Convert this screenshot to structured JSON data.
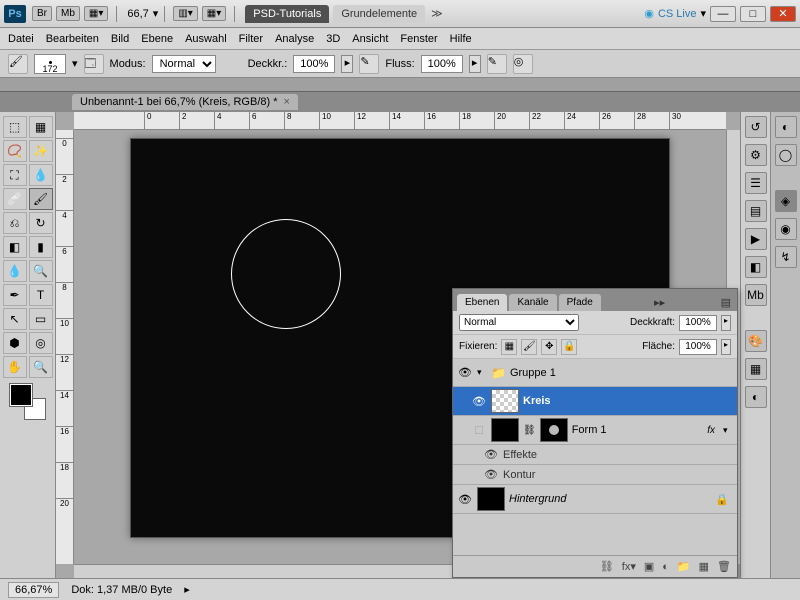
{
  "titlebar": {
    "ps": "Ps",
    "chips": [
      "Br",
      "Mb"
    ],
    "zoom": "66,7",
    "tutorials": "PSD-Tutorials",
    "workspace": "Grundelemente",
    "cslive": "CS Live"
  },
  "menu": [
    "Datei",
    "Bearbeiten",
    "Bild",
    "Ebene",
    "Auswahl",
    "Filter",
    "Analyse",
    "3D",
    "Ansicht",
    "Fenster",
    "Hilfe"
  ],
  "options": {
    "brush_size": "172",
    "mode_label": "Modus:",
    "mode_value": "Normal",
    "opacity_label": "Deckkr.:",
    "opacity_value": "100%",
    "flow_label": "Fluss:",
    "flow_value": "100%"
  },
  "doc_tab": "Unbenannt-1 bei 66,7% (Kreis, RGB/8) *",
  "ruler_h": [
    "0",
    "2",
    "4",
    "6",
    "8",
    "10",
    "12",
    "14",
    "16",
    "18",
    "20",
    "22",
    "24",
    "26",
    "28",
    "30"
  ],
  "ruler_v": [
    "0",
    "2",
    "4",
    "6",
    "8",
    "10",
    "12",
    "14",
    "16",
    "18",
    "20"
  ],
  "status": {
    "zoom": "66,67%",
    "doc": "Dok: 1,37 MB/0 Byte"
  },
  "layers_panel": {
    "tabs": [
      "Ebenen",
      "Kanäle",
      "Pfade"
    ],
    "blend": "Normal",
    "opacity_label": "Deckkraft:",
    "opacity": "100%",
    "lock_label": "Fixieren:",
    "fill_label": "Fläche:",
    "fill": "100%",
    "rows": {
      "group": "Gruppe 1",
      "kreis": "Kreis",
      "form1": "Form 1",
      "effekte": "Effekte",
      "kontur": "Kontur",
      "bg": "Hintergrund",
      "fx": "fx"
    }
  }
}
